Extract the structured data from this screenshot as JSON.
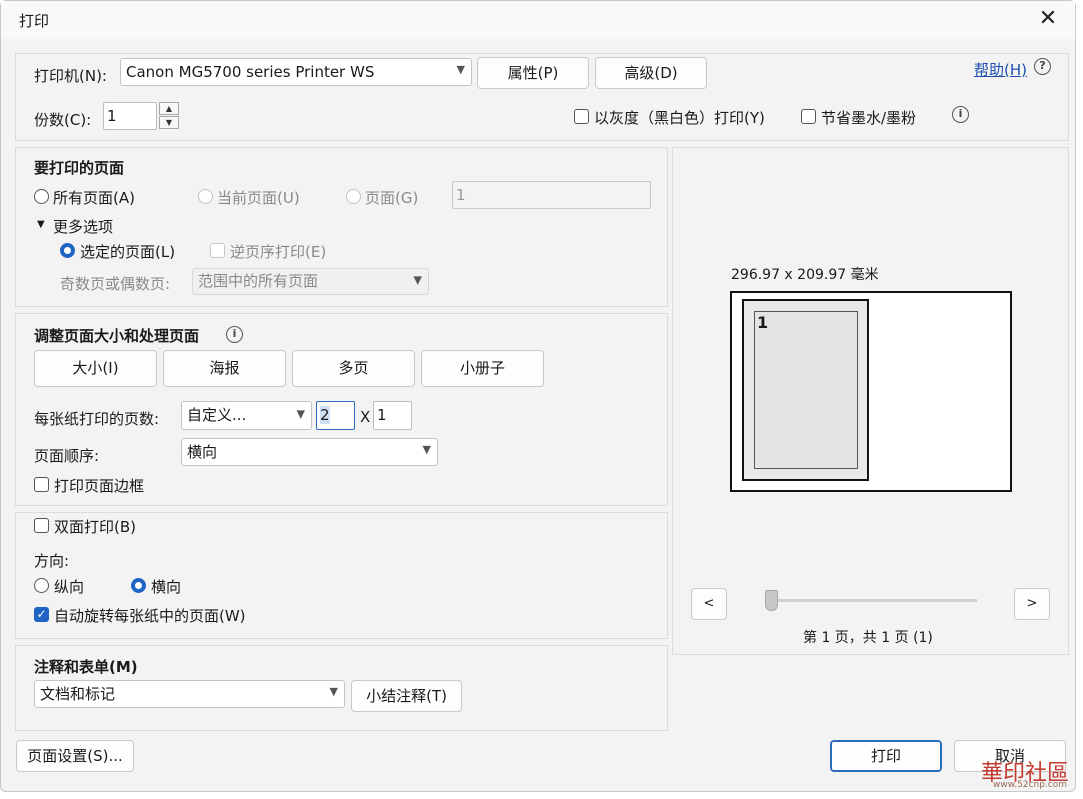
{
  "window": {
    "title": "打印",
    "close_glyph": "✕"
  },
  "printer": {
    "label": "打印机(N):",
    "selected": "Canon MG5700 series Printer WS",
    "properties_button": "属性(P)",
    "advanced_button": "高级(D)",
    "help_link": "帮助(H)"
  },
  "copies": {
    "label": "份数(C):",
    "value": "1",
    "grayscale_label": "以灰度（黑白色）打印(Y)",
    "save_ink_label": "节省墨水/墨粉"
  },
  "pages_to_print": {
    "heading": "要打印的页面",
    "all_pages": "所有页面(A)",
    "current_page": "当前页面(U)",
    "pages": "页面(G)",
    "pages_value": "1",
    "more_options": "更多选项",
    "selected_pages": "选定的页面(L)",
    "reverse_order": "逆页序打印(E)",
    "odd_even_label": "奇数页或偶数页:",
    "odd_even_value": "范围中的所有页面"
  },
  "page_sizing": {
    "heading": "调整页面大小和处理页面",
    "size_button": "大小(I)",
    "poster_button": "海报",
    "multiple_button": "多页",
    "booklet_button": "小册子",
    "pages_per_sheet_label": "每张纸打印的页数:",
    "pages_per_sheet_value": "自定义...",
    "cols_value": "2",
    "times": "X",
    "rows_value": "1",
    "page_order_label": "页面顺序:",
    "page_order_value": "横向",
    "print_border_label": "打印页面边框"
  },
  "duplex": {
    "label": "双面打印(B)",
    "orientation_label": "方向:",
    "portrait": "纵向",
    "landscape": "横向",
    "auto_rotate": "自动旋转每张纸中的页面(W)"
  },
  "comments": {
    "heading": "注释和表单(M)",
    "value": "文档和标记",
    "summarize_button": "小结注释(T)"
  },
  "preview": {
    "dimensions": "296.97 x 209.97 毫米",
    "page_number_label": "1",
    "prev": "<",
    "next": ">",
    "page_status": "第 1 页，共 1 页 (1)"
  },
  "footer": {
    "page_setup_button": "页面设置(S)...",
    "print_button": "打印",
    "cancel_button": "取消"
  },
  "watermark": {
    "text": "華印社區",
    "url": "www.52cnp.com"
  },
  "colors": {
    "accent": "#1f64c4",
    "link": "#1a4fb0",
    "background": "#f3f3f3"
  }
}
